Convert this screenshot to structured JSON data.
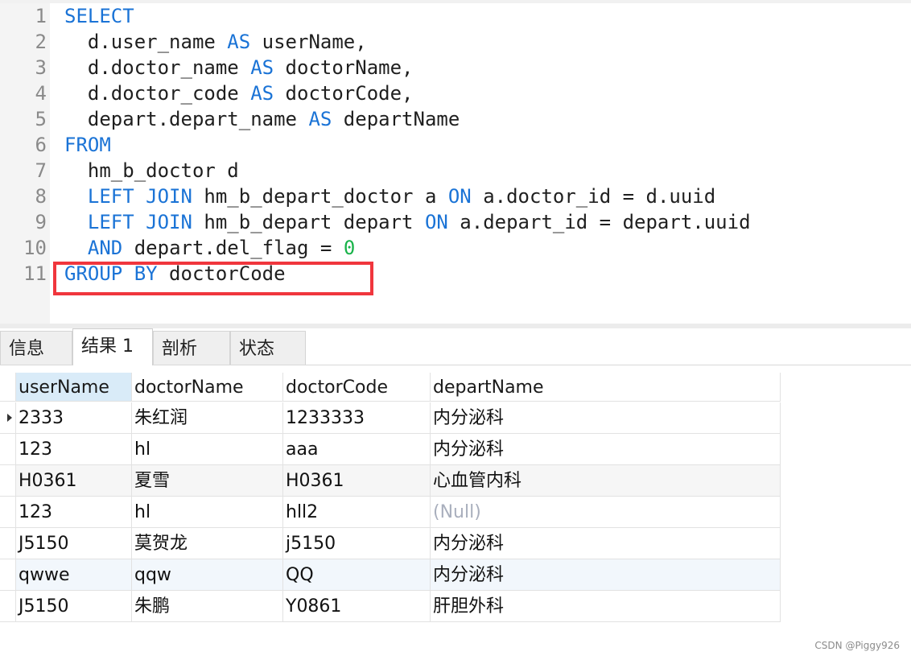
{
  "editor": {
    "lines": [
      {
        "n": "1",
        "segments": [
          {
            "t": "SELECT",
            "c": "kw"
          }
        ]
      },
      {
        "n": "2",
        "segments": [
          {
            "t": "  d.user_name ",
            "c": ""
          },
          {
            "t": "AS",
            "c": "kw"
          },
          {
            "t": " userName,",
            "c": ""
          }
        ]
      },
      {
        "n": "3",
        "segments": [
          {
            "t": "  d.doctor_name ",
            "c": ""
          },
          {
            "t": "AS",
            "c": "kw"
          },
          {
            "t": " doctorName,",
            "c": ""
          }
        ]
      },
      {
        "n": "4",
        "segments": [
          {
            "t": "  d.doctor_code ",
            "c": ""
          },
          {
            "t": "AS",
            "c": "kw"
          },
          {
            "t": " doctorCode,",
            "c": ""
          }
        ]
      },
      {
        "n": "5",
        "segments": [
          {
            "t": "  depart.depart_name ",
            "c": ""
          },
          {
            "t": "AS",
            "c": "kw"
          },
          {
            "t": " departName",
            "c": ""
          }
        ]
      },
      {
        "n": "6",
        "segments": [
          {
            "t": "FROM",
            "c": "kw"
          }
        ]
      },
      {
        "n": "7",
        "segments": [
          {
            "t": "  hm_b_doctor d",
            "c": ""
          }
        ]
      },
      {
        "n": "8",
        "segments": [
          {
            "t": "  ",
            "c": ""
          },
          {
            "t": "LEFT JOIN",
            "c": "kw"
          },
          {
            "t": " hm_b_depart_doctor a ",
            "c": ""
          },
          {
            "t": "ON",
            "c": "kw"
          },
          {
            "t": " a.doctor_id = d.uuid",
            "c": ""
          }
        ]
      },
      {
        "n": "9",
        "segments": [
          {
            "t": "  ",
            "c": ""
          },
          {
            "t": "LEFT JOIN",
            "c": "kw"
          },
          {
            "t": " hm_b_depart depart ",
            "c": ""
          },
          {
            "t": "ON",
            "c": "kw"
          },
          {
            "t": " a.depart_id = depart.uuid",
            "c": ""
          }
        ]
      },
      {
        "n": "10",
        "segments": [
          {
            "t": "  ",
            "c": ""
          },
          {
            "t": "AND",
            "c": "kw"
          },
          {
            "t": " depart.del_flag = ",
            "c": ""
          },
          {
            "t": "0",
            "c": "num"
          }
        ]
      },
      {
        "n": "11",
        "segments": [
          {
            "t": "GROUP BY",
            "c": "kw"
          },
          {
            "t": " doctorCode",
            "c": ""
          }
        ]
      }
    ]
  },
  "tabs": [
    {
      "label": "信息",
      "active": false
    },
    {
      "label": "结果 1",
      "active": true
    },
    {
      "label": "剖析",
      "active": false
    },
    {
      "label": "状态",
      "active": false
    }
  ],
  "grid": {
    "columns": [
      "userName",
      "doctorName",
      "doctorCode",
      "departName"
    ],
    "null_text": "(Null)",
    "rows": [
      [
        "2333",
        "朱红润",
        "1233333",
        "内分泌科"
      ],
      [
        "123",
        "hl",
        "aaa",
        "内分泌科"
      ],
      [
        "H0361",
        "夏雪",
        "H0361",
        "心血管内科"
      ],
      [
        "123",
        "hl",
        "hll2",
        null
      ],
      [
        "J5150",
        "莫贺龙",
        "j5150",
        "内分泌科"
      ],
      [
        "qwwe",
        "qqw",
        "QQ",
        "内分泌科"
      ],
      [
        "J5150",
        "朱鹏",
        "Y0861",
        "肝胆外科"
      ]
    ]
  },
  "watermark": "CSDN @Piggy926",
  "colors": {
    "keyword": "#1a73d6",
    "number": "#19b34a",
    "highlight_box": "#f0363d",
    "null": "#a9afbd"
  }
}
